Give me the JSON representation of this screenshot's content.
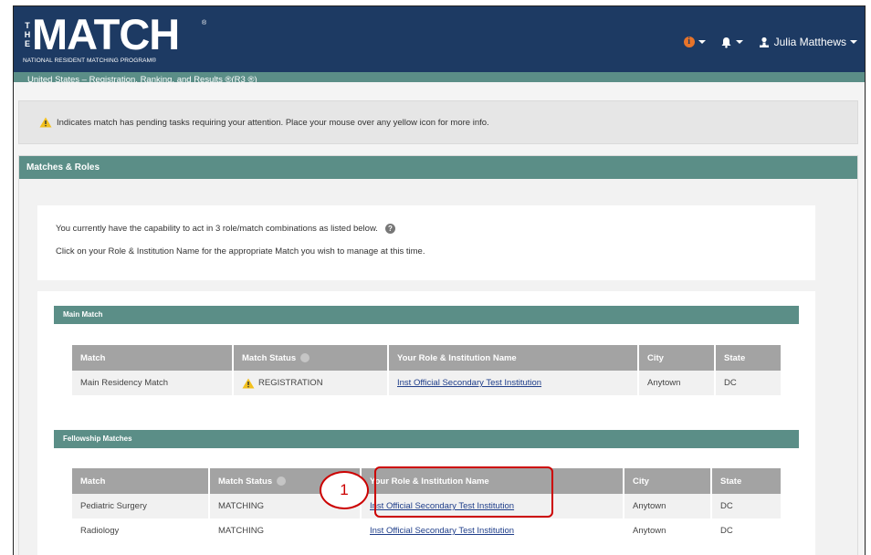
{
  "header": {
    "logo_the": "THE",
    "logo_main": "MATCH",
    "logo_reg": "®",
    "logo_sub": "NATIONAL RESIDENT MATCHING PROGRAM®",
    "user_name": "Julia Matthews"
  },
  "subbar": {
    "text": "United States  –  Registration, Ranking, and Results ®(R3 ®)"
  },
  "alert": {
    "text": "Indicates match has pending tasks requiring your attention. Place your mouse over any yellow icon for more info."
  },
  "panel": {
    "title": "Matches & Roles",
    "intro_line1": "You currently have the capability to act in 3 role/match combinations as listed below.",
    "intro_line2": "Click on your Role & Institution Name for the appropriate Match you wish to manage at this time."
  },
  "main_match": {
    "section_title": "Main Match",
    "headers": [
      "Match",
      "Match Status",
      "Your Role & Institution Name",
      "City",
      "State"
    ],
    "rows": [
      {
        "match": "Main Residency Match",
        "status": "REGISTRATION",
        "role": "Inst Official Secondary Test Institution",
        "city": "Anytown",
        "state": "DC"
      }
    ]
  },
  "fellowship": {
    "section_title": "Fellowship Matches",
    "headers": [
      "Match",
      "Match Status",
      "Your Role & Institution Name",
      "City",
      "State"
    ],
    "rows": [
      {
        "match": "Pediatric Surgery",
        "status": "MATCHING",
        "role": "Inst Official Secondary Test Institution",
        "city": "Anytown",
        "state": "DC"
      },
      {
        "match": "Radiology",
        "status": "MATCHING",
        "role": "Inst Official Secondary Test Institution",
        "city": "Anytown",
        "state": "DC"
      }
    ]
  },
  "callout": {
    "number": "1"
  },
  "colors": {
    "navy": "#1d3a63",
    "teal": "#5b8e87",
    "callout_red": "#cc0000",
    "warning_yellow": "#f2c01d",
    "info_orange": "#e8742a"
  }
}
